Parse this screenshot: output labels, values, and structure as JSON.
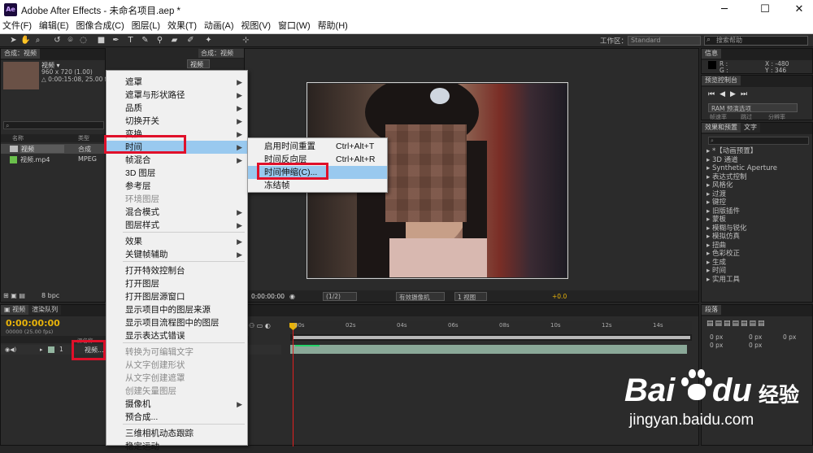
{
  "window": {
    "title": "Adobe After Effects - 未命名项目.aep *",
    "logo": "Ae"
  },
  "menubar": [
    "文件(F)",
    "编辑(E)",
    "图像合成(C)",
    "图层(L)",
    "效果(T)",
    "动画(A)",
    "视图(V)",
    "窗口(W)",
    "帮助(H)"
  ],
  "toolbar": {
    "workspace_label": "工作区：",
    "workspace_value": "Standard",
    "search_placeholder": "搜索帮助"
  },
  "project": {
    "tab": "项目",
    "item_name": "视频 ▾",
    "item_info1": "960 x 720 (1.00)",
    "item_info2": "△ 0:00:15:08, 25.00 fps",
    "col_name": "名称",
    "col_type": "类型",
    "rows": [
      {
        "name": "视频",
        "type": "合成"
      },
      {
        "name": "视频.mp4",
        "type": "MPEG"
      }
    ],
    "bpc": "8 bpc"
  },
  "comp": {
    "tab": "合成：视频",
    "subtab": "视频",
    "timecode": "0:00:00:00",
    "resolution": "(1/2)",
    "camera": "有效摄像机",
    "views": "1 视图",
    "offset": "+0.0"
  },
  "menu": {
    "items": [
      {
        "label": "遮罩",
        "arrow": true
      },
      {
        "label": "遮罩与形状路径",
        "arrow": true
      },
      {
        "label": "品质",
        "arrow": true
      },
      {
        "label": "切换开关",
        "arrow": true
      },
      {
        "label": "变换",
        "arrow": true
      },
      {
        "label": "时间",
        "arrow": true
      },
      {
        "label": "帧混合",
        "arrow": true
      },
      {
        "label": "3D 图层",
        "arrow": false
      },
      {
        "label": "参考层",
        "arrow": false
      },
      {
        "label": "环境图层",
        "arrow": false,
        "disabled": true
      },
      {
        "label": "混合模式",
        "arrow": true
      },
      {
        "label": "图层样式",
        "arrow": true
      },
      {
        "label": "效果",
        "arrow": true
      },
      {
        "label": "关键帧辅助",
        "arrow": true
      },
      {
        "label": "打开特效控制台",
        "arrow": false
      },
      {
        "label": "打开图层",
        "arrow": false
      },
      {
        "label": "打开图层源窗口",
        "arrow": false
      },
      {
        "label": "显示项目中的图层来源",
        "arrow": false
      },
      {
        "label": "显示项目流程图中的图层",
        "arrow": false
      },
      {
        "label": "显示表达式错误",
        "arrow": false
      },
      {
        "label": "转换为可编辑文字",
        "arrow": false,
        "disabled": true
      },
      {
        "label": "从文字创建形状",
        "arrow": false,
        "disabled": true
      },
      {
        "label": "从文字创建遮罩",
        "arrow": false,
        "disabled": true
      },
      {
        "label": "创建矢量图层",
        "arrow": false,
        "disabled": true
      },
      {
        "label": "摄像机",
        "arrow": true
      },
      {
        "label": "预合成...",
        "arrow": false
      },
      {
        "label": "三维相机动态跟踪",
        "arrow": false
      },
      {
        "label": "稳定运动",
        "arrow": false
      }
    ],
    "submenu": [
      {
        "label": "启用时间重置",
        "shortcut": "Ctrl+Alt+T"
      },
      {
        "label": "时间反向层",
        "shortcut": "Ctrl+Alt+R"
      },
      {
        "label": "时间伸缩(C)...",
        "shortcut": ""
      },
      {
        "label": "冻结帧",
        "shortcut": ""
      }
    ]
  },
  "info": {
    "tab": "信息",
    "r": "R :",
    "g": "G :",
    "x": "X : -480",
    "y": "Y : 346"
  },
  "preview": {
    "tab": "预览控制台",
    "ram": "RAM 预演选项",
    "frame_rate": "帧速率",
    "skip": "跳过",
    "resolution": "分辨率"
  },
  "effects": {
    "tab1": "效果和预置",
    "tab2": "文字",
    "items": [
      "*【动画预置】",
      "3D 通道",
      "Synthetic Aperture",
      "表达式控制",
      "风格化",
      "过渡",
      "键控",
      "旧版插件",
      "蒙板",
      "模糊与锐化",
      "模拟仿真",
      "扭曲",
      "色彩校正",
      "生成",
      "时间",
      "实用工具"
    ]
  },
  "paragraph": {
    "tab": "段落",
    "px1": "0 px",
    "px2": "0 px",
    "px3": "0 px",
    "px4": "0 px",
    "px5": "0 px"
  },
  "timeline": {
    "tab1": "视频",
    "tab2": "渲染队列",
    "timecode": "0:00:00:00",
    "fps": "00000 (25.00 fps)",
    "source_col": "源名称",
    "layer_num": "1",
    "layer_name": "视频...",
    "ticks": [
      "00s",
      "02s",
      "04s",
      "06s",
      "08s",
      "10s",
      "12s",
      "14s"
    ]
  },
  "watermark": {
    "brand": "Bai",
    "brand2": "du",
    "cn": "经验",
    "url": "jingyan.baidu.com"
  },
  "colors": {
    "highlight": "#99c9ef",
    "red_box": "#e0102a",
    "timecode": "#e8b30a"
  }
}
